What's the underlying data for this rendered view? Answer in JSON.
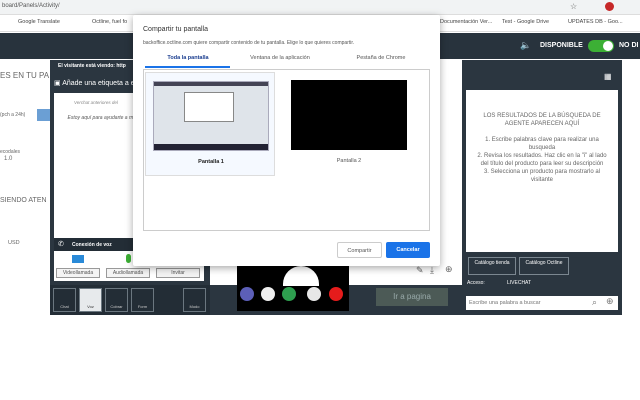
{
  "browser": {
    "url": "board/Panels/Activity/",
    "bookmarks": [
      "Google Translate",
      "Octline, fuel fo",
      "Documentación Ver...",
      "Test - Google Drive",
      "UPDATES DB - Goo..."
    ]
  },
  "header": {
    "status_label": "DISPONIBLE",
    "status_off_label": "NO DI",
    "toggle_on": true
  },
  "background_page": {
    "heading": "ES EN TU PA",
    "tag": "(pch a 24h)",
    "stat_label": "ecodales",
    "stat_value": "1.0",
    "section": "SIENDO ATEN",
    "currency": "USD"
  },
  "left_panel": {
    "viewing_label": "El visitante está viendo: http",
    "tag_label": "Añade una etiqueta a e",
    "system_message": "Verchat anteriores del",
    "welcome_message": "Estoy aquí para ayudarte a más rapido. Escribe en empe",
    "voice_label": "Conexión de voz",
    "video_call_label": "Videollamada",
    "audio_call_label": "Audiollamada",
    "invite_label": "Invitar",
    "tools": [
      "Chat",
      "Voz",
      "Cobrar",
      "Form",
      "",
      "Modo"
    ]
  },
  "center": {
    "go_page_label": "Ir a pagina"
  },
  "right_panel": {
    "results_heading": "LOS RESULTADOS DE LA BÚSQUEDA DE AGENTE APARECEN AQUÍ",
    "steps": [
      "1. Escribe palabras clave para realizar una busqueda",
      "2. Revisa los resultados. Haz clic en la \"i\" al lado del título del producto para leer su descripción",
      "3. Selecciona un producto para mostrarlo al visitante"
    ],
    "catalog_store": "Catálogo tienda",
    "catalog_octline": "Catálogo Octline",
    "access_label": "Acceso:",
    "access_value": "LIVECHAT",
    "search_placeholder": "Escribe una palabra a buscar"
  },
  "dialog": {
    "title": "Compartir tu pantalla",
    "subtitle": "backoffice.octline.com quiere compartir contenido de tu pantalla. Elige lo que quieres compartir.",
    "tabs": [
      "Toda la pantalla",
      "Ventana de la aplicación",
      "Pestaña de Chrome"
    ],
    "screens": [
      "Pantalla 1",
      "Pantalla 2"
    ],
    "share_label": "Compartir",
    "cancel_label": "Cancelar"
  },
  "colors": {
    "accent": "#1a73e8",
    "panel": "#2b3640",
    "toggle": "#3cb035"
  }
}
